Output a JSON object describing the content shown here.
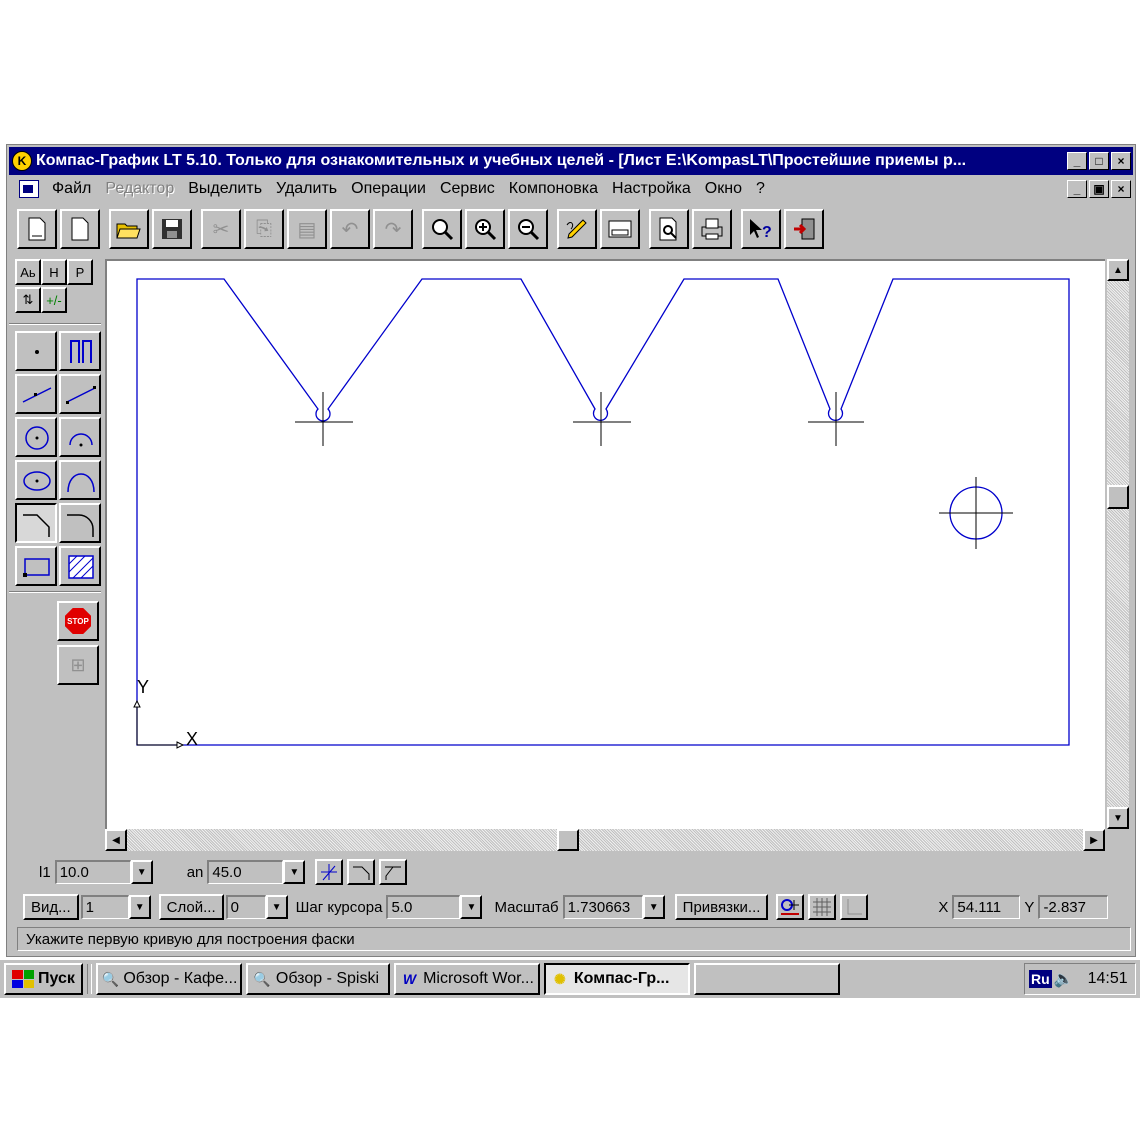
{
  "window": {
    "title": "Компас-График LT 5.10. Только для ознакомительных и учебных целей - [Лист E:\\KompasLT\\Простейшие приемы р...",
    "app_icon_letter": "K",
    "caption_buttons": [
      "_",
      "□",
      "×"
    ]
  },
  "menu": {
    "items": [
      {
        "label": "Файл",
        "enabled": true
      },
      {
        "label": "Редактор",
        "enabled": false
      },
      {
        "label": "Выделить",
        "enabled": true
      },
      {
        "label": "Удалить",
        "enabled": true
      },
      {
        "label": "Операции",
        "enabled": true
      },
      {
        "label": "Сервис",
        "enabled": true
      },
      {
        "label": "Компоновка",
        "enabled": true
      },
      {
        "label": "Настройка",
        "enabled": true
      },
      {
        "label": "Окно",
        "enabled": true
      },
      {
        "label": "?",
        "enabled": true
      }
    ],
    "caption_buttons": [
      "_",
      "▣",
      "×"
    ]
  },
  "toolbar": {
    "icons": [
      "new-sheet-icon",
      "new-fragment-icon",
      "open-icon",
      "save-icon",
      "cut-icon",
      "copy-icon",
      "paste-icon",
      "undo-icon",
      "redo-icon",
      "zoom-window-icon",
      "zoom-in-icon",
      "zoom-out-icon",
      "edit-icon",
      "sheet-format-icon",
      "preview-icon",
      "print-icon",
      "context-help-icon",
      "exit-icon"
    ]
  },
  "left_panel": {
    "tabs_top": [
      "Аь",
      "Н",
      "Р"
    ],
    "tabs_bottom": [
      "⇅",
      "+/-"
    ],
    "stop_label": "STOP"
  },
  "param_row": {
    "l1_label": "l1",
    "l1_value": "10.0",
    "an_label": "an",
    "an_value": "45.0"
  },
  "status_row": {
    "view_button": "Вид...",
    "view_value": "1",
    "layer_button": "Слой...",
    "layer_value": "0",
    "step_label": "Шаг курсора",
    "step_value": "5.0",
    "scale_label": "Масштаб",
    "scale_value": "1.730663",
    "snaps_button": "Привязки...",
    "x_label": "X",
    "x_value": "54.111",
    "y_label": "Y",
    "y_value": "-2.837"
  },
  "hint": "Укажите первую кривую для построения фаски",
  "drawing": {
    "axis_x": "X",
    "axis_y": "Y",
    "line_color": "#0000cc"
  },
  "taskbar": {
    "start": "Пуск",
    "tasks": [
      {
        "label": "Обзор - Кафе...",
        "active": false,
        "icon": "explorer-icon"
      },
      {
        "label": "Обзор - Spiski",
        "active": false,
        "icon": "explorer-icon"
      },
      {
        "label": "Microsoft Wor...",
        "active": false,
        "icon": "word-icon"
      },
      {
        "label": "Компас-Гр...",
        "active": true,
        "icon": "kompas-icon"
      }
    ],
    "lang": "Ru",
    "clock": "14:51"
  }
}
